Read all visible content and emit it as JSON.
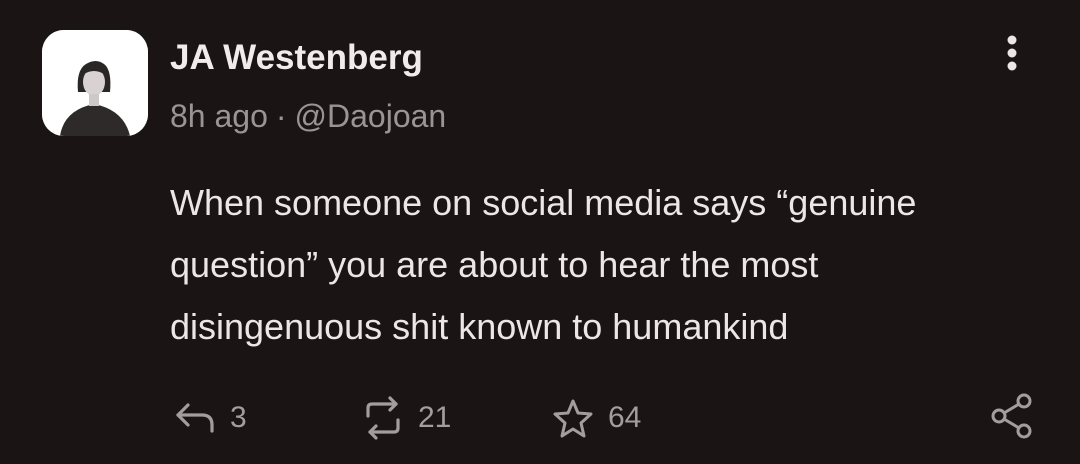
{
  "post": {
    "author_name": "JA Westenberg",
    "time_ago": "8h ago",
    "separator": "·",
    "handle": "@Daojoan",
    "text_lines": [
      "When someone on social media says “genuine",
      "question” you are about to hear the most",
      "disingenuous shit known to humankind"
    ]
  },
  "actions": {
    "reply_count": "3",
    "repost_count": "21",
    "like_count": "64"
  },
  "icons": {
    "more": "more-vertical-icon",
    "reply": "reply-arrow-icon",
    "repost": "repost-icon",
    "like": "star-icon",
    "share": "share-icon"
  },
  "colors": {
    "background": "#1a1414",
    "text": "#ece6e6",
    "muted": "#9c9494",
    "avatar_bg": "#ffffff"
  }
}
